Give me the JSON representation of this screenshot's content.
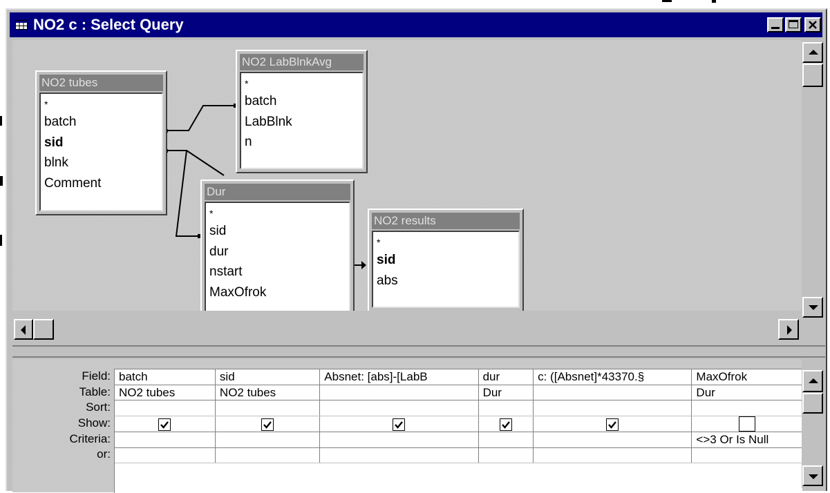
{
  "window": {
    "title": "NO2 c : Select Query",
    "controls": [
      "minimize",
      "maximize",
      "close"
    ]
  },
  "tables": [
    {
      "id": "no2-tubes",
      "title": "NO2 tubes",
      "fields": [
        {
          "label": "*",
          "bold": false
        },
        {
          "label": "batch",
          "bold": false
        },
        {
          "label": "sid",
          "bold": true
        },
        {
          "label": "blnk",
          "bold": false
        },
        {
          "label": "Comment",
          "bold": false
        }
      ]
    },
    {
      "id": "no2-labblnkavg",
      "title": "NO2 LabBlnkAvg",
      "fields": [
        {
          "label": "*",
          "bold": false
        },
        {
          "label": "batch",
          "bold": false
        },
        {
          "label": "LabBlnk",
          "bold": false
        },
        {
          "label": "n",
          "bold": false
        }
      ]
    },
    {
      "id": "dur",
      "title": "Dur",
      "fields": [
        {
          "label": "*",
          "bold": false
        },
        {
          "label": "sid",
          "bold": false
        },
        {
          "label": "dur",
          "bold": false
        },
        {
          "label": "nstart",
          "bold": false
        },
        {
          "label": "MaxOfrok",
          "bold": false
        }
      ]
    },
    {
      "id": "no2-results",
      "title": "NO2 results",
      "fields": [
        {
          "label": "*",
          "bold": false
        },
        {
          "label": "sid",
          "bold": true
        },
        {
          "label": "abs",
          "bold": false
        }
      ]
    }
  ],
  "design_grid": {
    "row_labels": [
      "Field:",
      "Table:",
      "Sort:",
      "Show:",
      "Criteria:",
      "or:"
    ],
    "columns": [
      {
        "field": "batch",
        "table": "NO2 tubes",
        "sort": "",
        "show": true,
        "criteria": "",
        "or": ""
      },
      {
        "field": "sid",
        "table": "NO2 tubes",
        "sort": "",
        "show": true,
        "criteria": "",
        "or": ""
      },
      {
        "field": "Absnet: [abs]-[LabB",
        "table": "",
        "sort": "",
        "show": true,
        "criteria": "",
        "or": ""
      },
      {
        "field": "dur",
        "table": "Dur",
        "sort": "",
        "show": true,
        "criteria": "",
        "or": ""
      },
      {
        "field": "c: ([Absnet]*43370.§",
        "table": "",
        "sort": "",
        "show": true,
        "criteria": "",
        "or": ""
      },
      {
        "field": "MaxOfrok",
        "table": "Dur",
        "sort": "",
        "show": false,
        "criteria": "<>3 Or Is Null",
        "or": ""
      }
    ]
  },
  "icons": {
    "system_menu": "datasheet-icon",
    "scroll_up": "triangle-up-icon",
    "scroll_down": "triangle-down-icon",
    "scroll_left": "triangle-left-icon",
    "scroll_right": "triangle-right-icon"
  },
  "colors": {
    "title_bar": "#000080",
    "window_face": "#c0c0c0",
    "table_title": "#808080"
  }
}
